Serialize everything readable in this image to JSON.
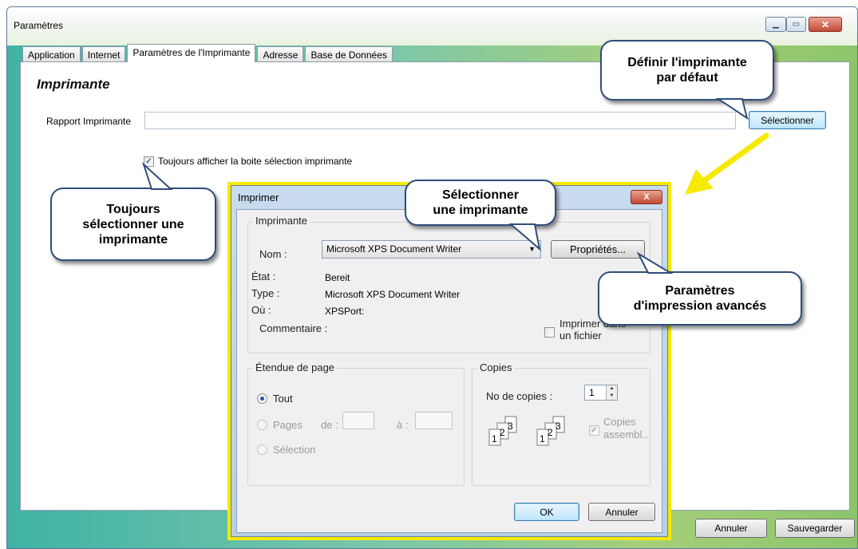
{
  "window": {
    "title": "Paramètres"
  },
  "tabs": [
    "Application",
    "Internet",
    "Paramètres de l'Imprimante",
    "Adresse",
    "Base de Données"
  ],
  "section": {
    "title": "Imprimante"
  },
  "rapport": {
    "label": "Rapport Imprimante",
    "value": "",
    "button": "Sélectionner"
  },
  "always_show": {
    "label": "Toujours afficher la boite sélection imprimante",
    "checked": true
  },
  "footer": {
    "cancel": "Annuler",
    "save": "Sauvegarder"
  },
  "callouts": {
    "default_printer": "Définir l'imprimante\npar défaut",
    "always_select": "Toujours\nsélectionner une\nimprimante",
    "select_printer": "Sélectionner\nune imprimante",
    "advanced": "Paramètres\nd'impression avancés"
  },
  "print_dialog": {
    "title": "Imprimer",
    "close": "X",
    "printer_group": "Imprimante",
    "name_label": "Nom :",
    "name_value": "Microsoft XPS Document Writer",
    "properties_button": "Propriétés...",
    "status_label": "État :",
    "status_value": "Bereit",
    "type_label": "Type :",
    "type_value": "Microsoft XPS Document Writer",
    "where_label": "Où :",
    "where_value": "XPSPort:",
    "comment_label": "Commentaire :",
    "print_to_file": "Imprimer dans\nun fichier",
    "range_group": "Étendue de page",
    "range_all": "Tout",
    "range_pages": "Pages",
    "range_from": "de :",
    "range_to": "à :",
    "range_selection": "Sélection",
    "copies_group": "Copies",
    "copies_label": "No de copies :",
    "copies_value": "1",
    "collate_label": "Copies\nassembl..",
    "collate_checked": true,
    "ok": "OK",
    "cancel": "Annuler"
  },
  "colors": {
    "highlight": "#f5ea00",
    "callout_border": "#2f4d7a",
    "arrow": "#f5ea00"
  }
}
